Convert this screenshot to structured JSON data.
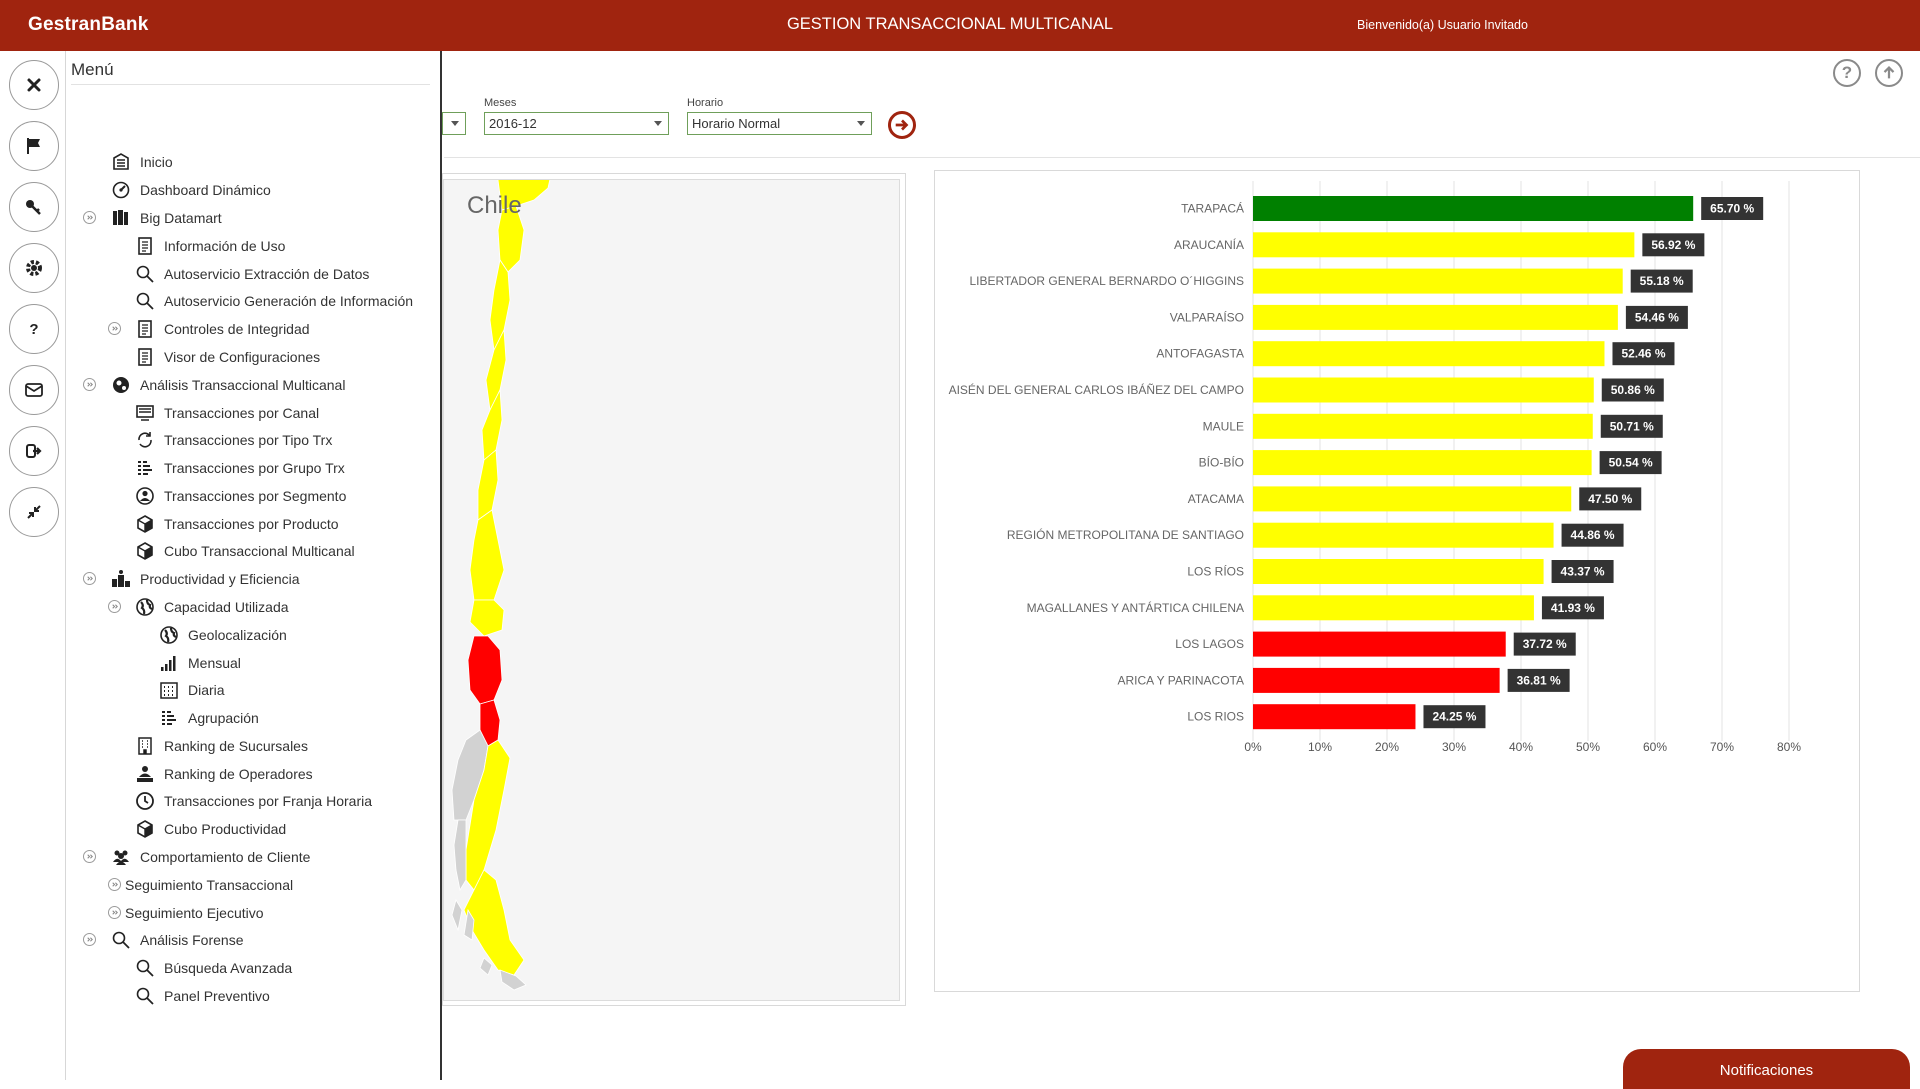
{
  "header": {
    "brand": "GestranBank",
    "title": "GESTION TRANSACCIONAL MULTICANAL",
    "welcome": "Bienvenido(a) Usuario Invitado"
  },
  "rail": [
    "close-icon",
    "flag-icon",
    "key-icon",
    "gear-icon",
    "help-icon",
    "mail-icon",
    "logout-icon",
    "collapse-icon"
  ],
  "menu": {
    "title": "Menú",
    "items": [
      {
        "label": "Inicio",
        "icon": "home-icon"
      },
      {
        "label": "Dashboard Dinámico",
        "icon": "dashboard-icon"
      },
      {
        "label": "Big Datamart",
        "icon": "datamart-icon"
      },
      {
        "label": "Información de Uso",
        "icon": "document-icon"
      },
      {
        "label": "Autoservicio Extracción de Datos",
        "icon": "search-icon"
      },
      {
        "label": "Autoservicio Generación de Información",
        "icon": "search-icon"
      },
      {
        "label": "Controles de Integridad",
        "icon": "document-icon"
      },
      {
        "label": "Visor de Configuraciones",
        "icon": "document-icon"
      },
      {
        "label": "Análisis Transaccional Multicanal",
        "icon": "gears-icon"
      },
      {
        "label": "Transacciones por Canal",
        "icon": "channel-icon"
      },
      {
        "label": "Transacciones por Tipo Trx",
        "icon": "refresh-icon"
      },
      {
        "label": "Transacciones por Grupo Trx",
        "icon": "list-icon"
      },
      {
        "label": "Transacciones por Segmento",
        "icon": "user-icon"
      },
      {
        "label": "Transacciones por Producto",
        "icon": "cube-icon"
      },
      {
        "label": "Cubo Transaccional Multicanal",
        "icon": "cube-icon"
      },
      {
        "label": "Productividad y Eficiencia",
        "icon": "podium-icon"
      },
      {
        "label": "Capacidad Utilizada",
        "icon": "globe-icon"
      },
      {
        "label": "Geolocalización",
        "icon": "globe-icon"
      },
      {
        "label": "Mensual",
        "icon": "signal-icon"
      },
      {
        "label": "Diaria",
        "icon": "calendar-icon"
      },
      {
        "label": "Agrupación",
        "icon": "list-icon"
      },
      {
        "label": "Ranking de Sucursales",
        "icon": "building-icon"
      },
      {
        "label": "Ranking de Operadores",
        "icon": "operator-icon"
      },
      {
        "label": "Transacciones por Franja Horaria",
        "icon": "clock-icon"
      },
      {
        "label": "Cubo Productividad",
        "icon": "cube-icon"
      },
      {
        "label": "Comportamiento de Cliente",
        "icon": "group-icon"
      },
      {
        "label": "Seguimiento Transaccional",
        "icon": ""
      },
      {
        "label": "Seguimiento Ejecutivo",
        "icon": ""
      },
      {
        "label": "Análisis Forense",
        "icon": "search-icon"
      },
      {
        "label": "Búsqueda Avanzada",
        "icon": "search-icon"
      },
      {
        "label": "Panel Preventivo",
        "icon": "search-icon"
      }
    ]
  },
  "filters": {
    "meses_label": "Meses",
    "meses_value": "2016-12",
    "horario_label": "Horario",
    "horario_value": "Horario Normal"
  },
  "map": {
    "title": "Chile",
    "colors": {
      "green": "#008000",
      "yellow": "#ffff00",
      "red": "#ff0000",
      "gray": "#d2d2d2"
    }
  },
  "chart_data": {
    "type": "bar",
    "orientation": "horizontal",
    "categories": [
      "TARAPACÁ",
      "ARAUCANÍA",
      "LIBERTADOR GENERAL BERNARDO O´HIGGINS",
      "VALPARAÍSO",
      "ANTOFAGASTA",
      "AISÉN DEL GENERAL CARLOS IBÁÑEZ DEL CAMPO",
      "MAULE",
      "BÍO-BÍO",
      "ATACAMA",
      "REGIÓN METROPOLITANA DE SANTIAGO",
      "LOS RÍOS",
      "MAGALLANES Y ANTÁRTICA CHILENA",
      "LOS LAGOS",
      "ARICA Y PARINACOTA",
      "LOS RIOS"
    ],
    "values": [
      65.7,
      56.92,
      55.18,
      54.46,
      52.46,
      50.86,
      50.71,
      50.54,
      47.5,
      44.86,
      43.37,
      41.93,
      37.72,
      36.81,
      24.25
    ],
    "labels": [
      "65.70 %",
      "56.92 %",
      "55.18 %",
      "54.46 %",
      "52.46 %",
      "50.86 %",
      "50.71 %",
      "50.54 %",
      "47.50 %",
      "44.86 %",
      "43.37 %",
      "41.93 %",
      "37.72 %",
      "36.81 %",
      "24.25 %"
    ],
    "colors": [
      "#008000",
      "#ffff00",
      "#ffff00",
      "#ffff00",
      "#ffff00",
      "#ffff00",
      "#ffff00",
      "#ffff00",
      "#ffff00",
      "#ffff00",
      "#ffff00",
      "#ffff00",
      "#ff0000",
      "#ff0000",
      "#ff0000"
    ],
    "xticks": [
      "0%",
      "10%",
      "20%",
      "30%",
      "40%",
      "50%",
      "60%",
      "70%",
      "80%"
    ],
    "xlim": [
      0,
      80
    ],
    "grid": true
  },
  "notifications": {
    "label": "Notificaciones"
  }
}
